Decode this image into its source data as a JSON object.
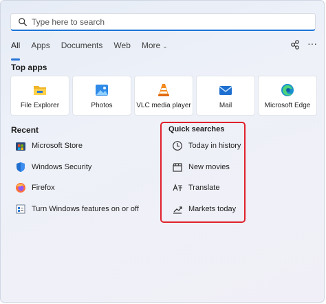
{
  "search": {
    "placeholder": "Type here to search"
  },
  "tabs": [
    {
      "label": "All"
    },
    {
      "label": "Apps"
    },
    {
      "label": "Documents"
    },
    {
      "label": "Web"
    },
    {
      "label": "More"
    }
  ],
  "top_apps": {
    "title": "Top apps",
    "items": [
      {
        "label": "File Explorer",
        "icon": "folder-icon"
      },
      {
        "label": "Photos",
        "icon": "photos-icon"
      },
      {
        "label": "VLC media player",
        "icon": "vlc-cone-icon"
      },
      {
        "label": "Mail",
        "icon": "mail-icon"
      },
      {
        "label": "Microsoft Edge",
        "icon": "edge-icon"
      }
    ]
  },
  "recent": {
    "title": "Recent",
    "items": [
      {
        "label": "Microsoft Store",
        "icon": "store-icon"
      },
      {
        "label": "Windows Security",
        "icon": "shield-icon"
      },
      {
        "label": "Firefox",
        "icon": "firefox-icon"
      },
      {
        "label": "Turn Windows features on or off",
        "icon": "features-icon"
      }
    ]
  },
  "quick_searches": {
    "title": "Quick searches",
    "items": [
      {
        "label": "Today in history",
        "icon": "clock-icon"
      },
      {
        "label": "New movies",
        "icon": "clapperboard-icon"
      },
      {
        "label": "Translate",
        "icon": "translate-icon"
      },
      {
        "label": "Markets today",
        "icon": "chart-icon"
      }
    ]
  },
  "colors": {
    "accent": "#2773d8",
    "highlight_border": "#e0202a"
  }
}
